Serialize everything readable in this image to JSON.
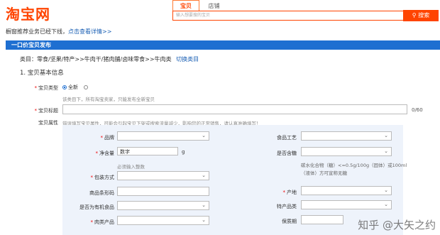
{
  "header": {
    "logo": "淘宝网",
    "tabs": [
      "宝贝",
      "店铺"
    ],
    "search_placeholder": "输入想要搜的宝贝",
    "search_button": "搜索",
    "notice_text": "橱窗推荐业务已经下线，",
    "notice_link": "点击查看详情>>"
  },
  "page": {
    "title": "一口价宝贝发布",
    "category_path": "类目：零食/坚果/特产>>牛肉干/猪肉脯/卤味零食>>牛肉类",
    "switch_category": "切换类目",
    "section_heading": "1. 宝贝基本信息"
  },
  "form": {
    "type_label": "宝贝类型",
    "type_option_new": "全新",
    "type_hint": "该类目下，所有淘宝卖家，只能发布全新宝贝",
    "title_label": "宝贝标题",
    "title_counter": "0/60",
    "attr_label": "宝贝属性",
    "attr_hint": "错误填写宝贝属性，可能会引起宝贝下架或搜索流量减少，影响您的正常销售，请认真准确填写！"
  },
  "attributes": {
    "brand": "品牌",
    "food_process": "食品工艺",
    "net_content": "净含量",
    "net_content_value": "数字",
    "net_content_unit": "g",
    "is_sugar_free": "是否含糖",
    "net_content_hint": "必须输入整数",
    "sugar_hint": "碳水化合物（糖）<=0.5g/100g（固体）或100ml（液体）方可宣称无糖",
    "packaging": "包装方式",
    "barcode": "商品条形码",
    "origin": "产地",
    "organic": "是否为有机食品",
    "specialty": "特产品类",
    "meat_product": "肉类产品",
    "shelf_life": "保质期"
  },
  "watermark": "知乎 @大矢之约"
}
